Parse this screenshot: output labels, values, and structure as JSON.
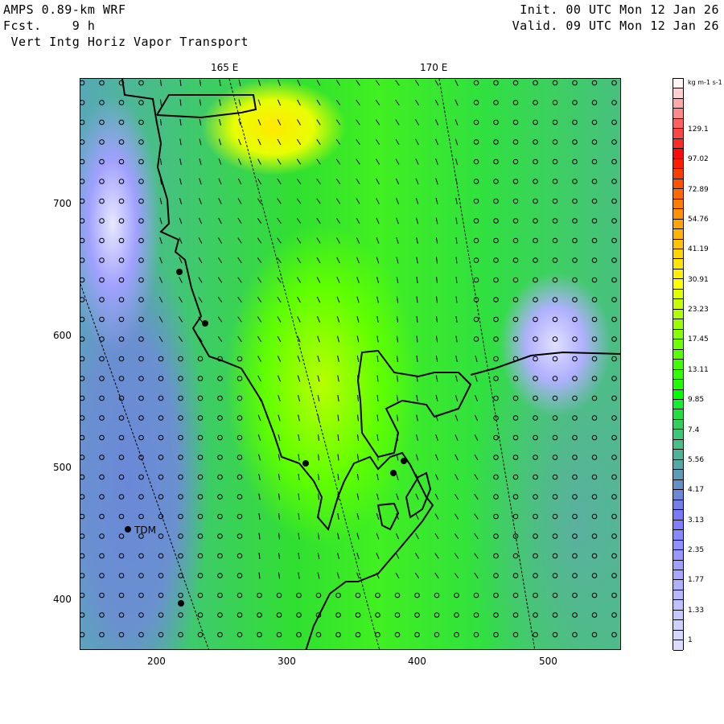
{
  "header": {
    "model": "AMPS 0.89-km WRF",
    "fcst": "Fcst.    9 h",
    "field": " Vert Intg Horiz Vapor Transport",
    "init": "Init. 00 UTC Mon 12 Jan 26",
    "valid": "Valid. 09 UTC Mon 12 Jan 26"
  },
  "lon_labels": [
    "165 E",
    "170 E"
  ],
  "x_ticks": [
    "200",
    "300",
    "400",
    "500"
  ],
  "y_ticks": [
    "700",
    "600",
    "500",
    "400"
  ],
  "stations": [
    {
      "label": "TDM"
    }
  ],
  "colorbar": {
    "units": "kg m-1 s-1",
    "labels": [
      "129.1",
      "97.02",
      "72.89",
      "54.76",
      "41.19",
      "30.91",
      "23.23",
      "17.45",
      "13.11",
      "9.85",
      "7.4",
      "5.56",
      "4.17",
      "3.13",
      "2.35",
      "1.77",
      "1.33",
      "1"
    ],
    "colors": [
      "#fff4f4",
      "#ffd0d0",
      "#ffa8a8",
      "#ff8888",
      "#ff6060",
      "#ff4646",
      "#ff2a2a",
      "#ff0a0a",
      "#ff1e00",
      "#ff3c00",
      "#ff5200",
      "#ff6a00",
      "#ff7e00",
      "#ff9200",
      "#ffa400",
      "#ffb400",
      "#ffc400",
      "#ffd600",
      "#ffe600",
      "#fff200",
      "#ffff00",
      "#e0ff00",
      "#c8ff00",
      "#b0ff00",
      "#9cff00",
      "#88ff00",
      "#70ff00",
      "#58ff00",
      "#40ff00",
      "#30ff00",
      "#1cff00",
      "#00ff00",
      "#10f030",
      "#20e040",
      "#30d060",
      "#3cc878",
      "#44c088",
      "#4cb498",
      "#54a8a8",
      "#5c9cb8",
      "#6490c8",
      "#6c88d8",
      "#7480e8",
      "#7a7af8",
      "#8080ff",
      "#8888ff",
      "#9090ff",
      "#9898ff",
      "#a0a0ff",
      "#a8a8ff",
      "#b0b0ff",
      "#b8b8ff",
      "#c0c0ff",
      "#c8c8ff",
      "#d0d0ff",
      "#d6d6ff",
      "#dcdcff"
    ]
  }
}
